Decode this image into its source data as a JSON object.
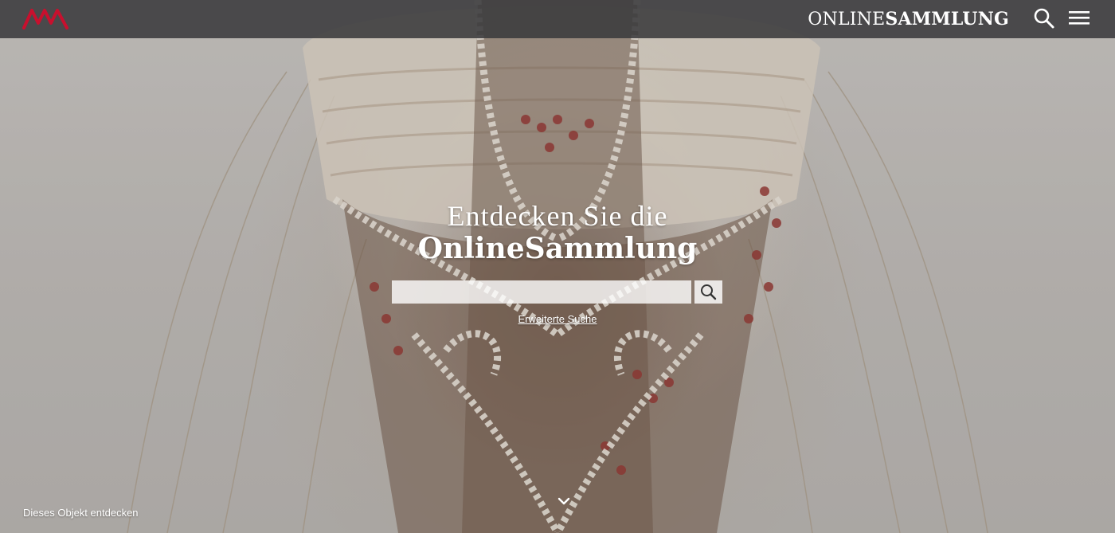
{
  "header": {
    "brand_light": "ONLINE",
    "brand_bold": "SAMMLUNG",
    "logo_icon": "museum-logo-icon",
    "search_icon": "search-icon",
    "menu_icon": "hamburger-menu-icon",
    "logo_color": "#c8102e"
  },
  "hero": {
    "title_line1": "Entdecken Sie die",
    "title_line2": "OnlineSammlung",
    "search": {
      "value": "",
      "placeholder": "",
      "button_icon": "search-icon"
    },
    "advanced_search_label": "Erweiterte Suche"
  },
  "footer": {
    "discover_label": "Dieses Objekt entdecken",
    "scroll_icon": "chevron-down-icon"
  }
}
